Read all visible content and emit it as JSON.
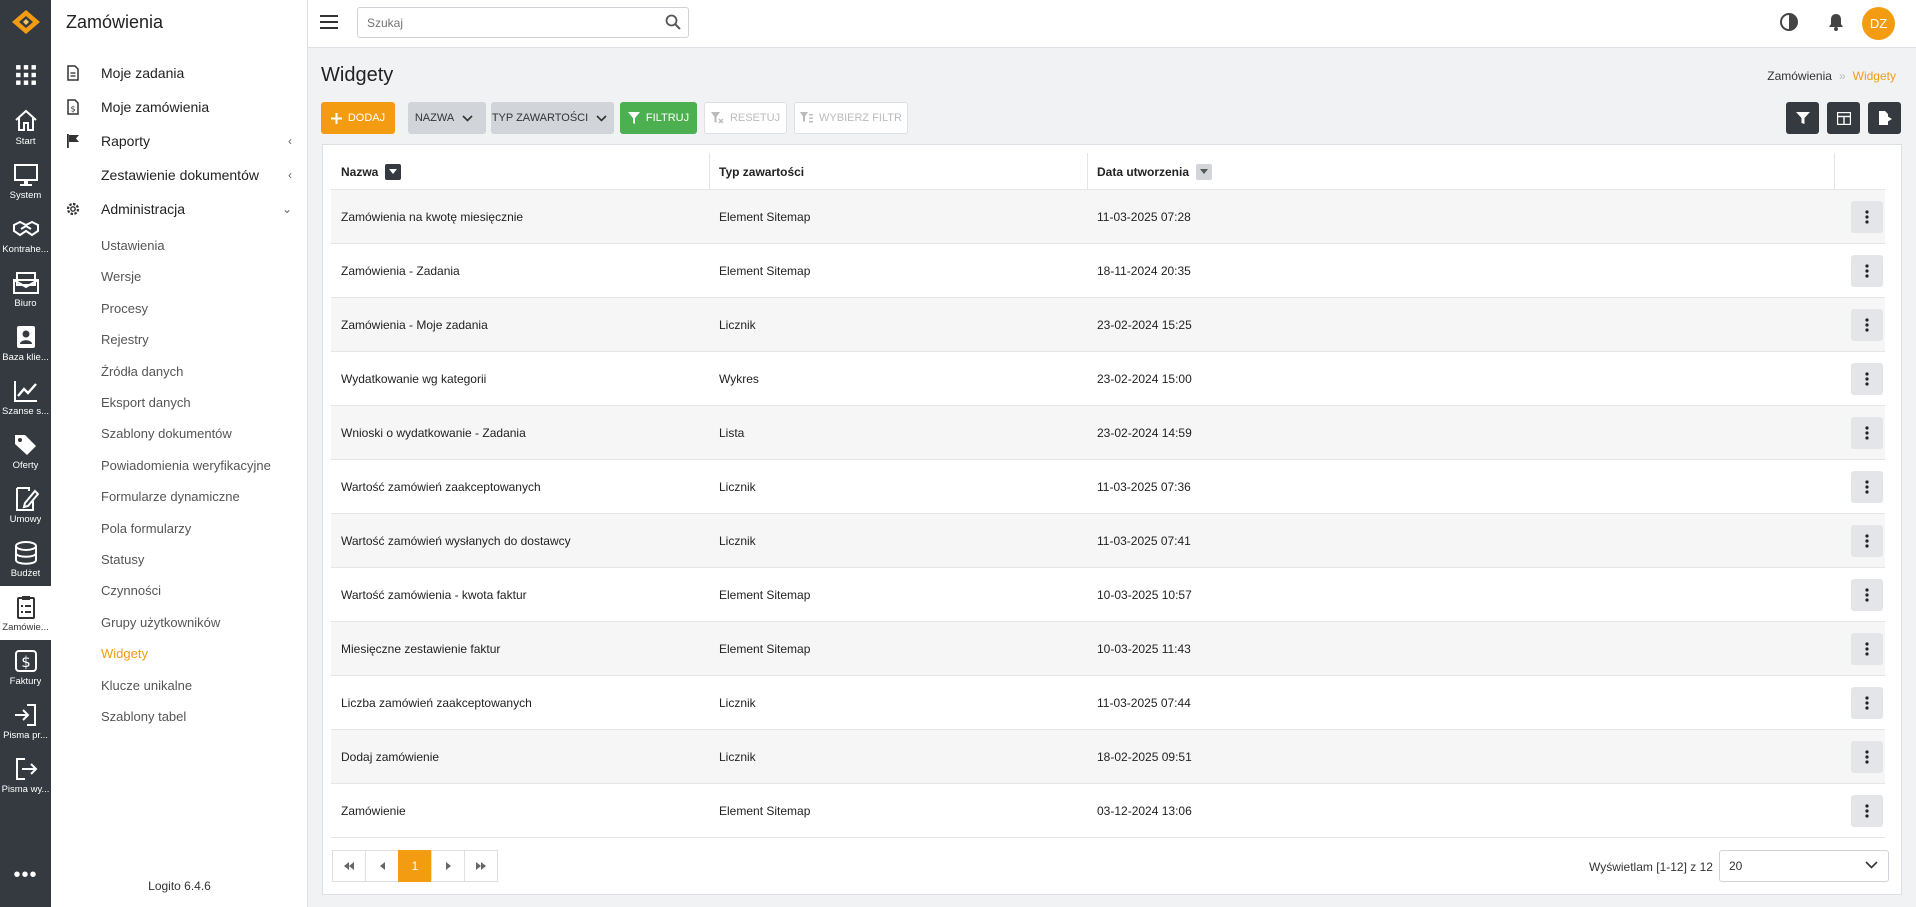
{
  "rail": {
    "items": [
      {
        "label": "Start",
        "icon": "home-icon"
      },
      {
        "label": "System",
        "icon": "monitor-icon"
      },
      {
        "label": "Kontrahe...",
        "icon": "handshake-icon"
      },
      {
        "label": "Biuro",
        "icon": "mail-icon"
      },
      {
        "label": "Baza klie...",
        "icon": "contact-card-icon"
      },
      {
        "label": "Szanse s...",
        "icon": "chart-line-icon"
      },
      {
        "label": "Oferty",
        "icon": "tags-icon"
      },
      {
        "label": "Umowy",
        "icon": "edit-document-icon"
      },
      {
        "label": "Budżet",
        "icon": "coins-icon"
      },
      {
        "label": "Zamówie...",
        "icon": "clipboard-list-icon"
      },
      {
        "label": "Faktury",
        "icon": "dollar-icon"
      },
      {
        "label": "Pisma pr...",
        "icon": "sign-in-icon"
      },
      {
        "label": "Pisma wy...",
        "icon": "sign-out-icon"
      }
    ],
    "more": "•••"
  },
  "sidebar": {
    "title": "Zamówienia",
    "main_items": [
      {
        "label": "Moje zadania",
        "icon": "document-icon",
        "chevron": ""
      },
      {
        "label": "Moje zamówienia",
        "icon": "document-dollar-icon",
        "chevron": ""
      },
      {
        "label": "Raporty",
        "icon": "flag-icon",
        "chevron": "‹"
      },
      {
        "label": "Zestawienie dokumentów",
        "icon": "",
        "chevron": "‹"
      },
      {
        "label": "Administracja",
        "icon": "gear-icon",
        "chevron": "⌄"
      }
    ],
    "sub_items": [
      "Ustawienia",
      "Wersje",
      "Procesy",
      "Rejestry",
      "Źródła danych",
      "Eksport danych",
      "Szablony dokumentów",
      "Powiadomienia weryfikacyjne",
      "Formularze dynamiczne",
      "Pola formularzy",
      "Statusy",
      "Czynności",
      "Grupy użytkowników",
      "Widgety",
      "Klucze unikalne",
      "Szablony tabel"
    ],
    "active_sub": "Widgety",
    "version": "Logito 6.4.6"
  },
  "topbar": {
    "search_placeholder": "Szukaj",
    "avatar_initials": "DZ"
  },
  "page": {
    "title": "Widgety",
    "breadcrumb": [
      "Zamówienia",
      "Widgety"
    ]
  },
  "toolbar": {
    "add_label": "DODAJ",
    "name_dropdown": "NAZWA",
    "type_dropdown": "TYP ZAWARTOŚCI",
    "filter_label": "FILTRUJ",
    "reset_label": "RESETUJ",
    "choose_filter_label": "WYBIERZ FILTR"
  },
  "table": {
    "columns": [
      "Nazwa",
      "Typ zawartości",
      "Data utworzenia"
    ],
    "rows": [
      [
        "Zamówienia na kwotę miesięcznie",
        "Element Sitemap",
        "11-03-2025 07:28"
      ],
      [
        "Zamówienia - Zadania",
        "Element Sitemap",
        "18-11-2024 20:35"
      ],
      [
        "Zamówienia - Moje zadania",
        "Licznik",
        "23-02-2024 15:25"
      ],
      [
        "Wydatkowanie wg kategorii",
        "Wykres",
        "23-02-2024 15:00"
      ],
      [
        "Wnioski o wydatkowanie - Zadania",
        "Lista",
        "23-02-2024 14:59"
      ],
      [
        "Wartość zamówień zaakceptowanych",
        "Licznik",
        "11-03-2025 07:36"
      ],
      [
        "Wartość zamówień wysłanych do dostawcy",
        "Licznik",
        "11-03-2025 07:41"
      ],
      [
        "Wartość zamówienia - kwota faktur",
        "Element Sitemap",
        "10-03-2025 10:57"
      ],
      [
        "Miesięczne zestawienie faktur",
        "Element Sitemap",
        "10-03-2025 11:43"
      ],
      [
        "Liczba zamówień zaakceptowanych",
        "Licznik",
        "11-03-2025 07:44"
      ],
      [
        "Dodaj zamówienie",
        "Licznik",
        "18-02-2025 09:51"
      ],
      [
        "Zamówienie",
        "Element Sitemap",
        "03-12-2024 13:06"
      ]
    ]
  },
  "pagination": {
    "current_page": "1",
    "showing_text": "Wyświetlam [1-12] z 12",
    "page_size": "20"
  },
  "colors": {
    "accent": "#f39c12",
    "filter_green": "#4caf50",
    "rail_bg": "#343a40"
  }
}
